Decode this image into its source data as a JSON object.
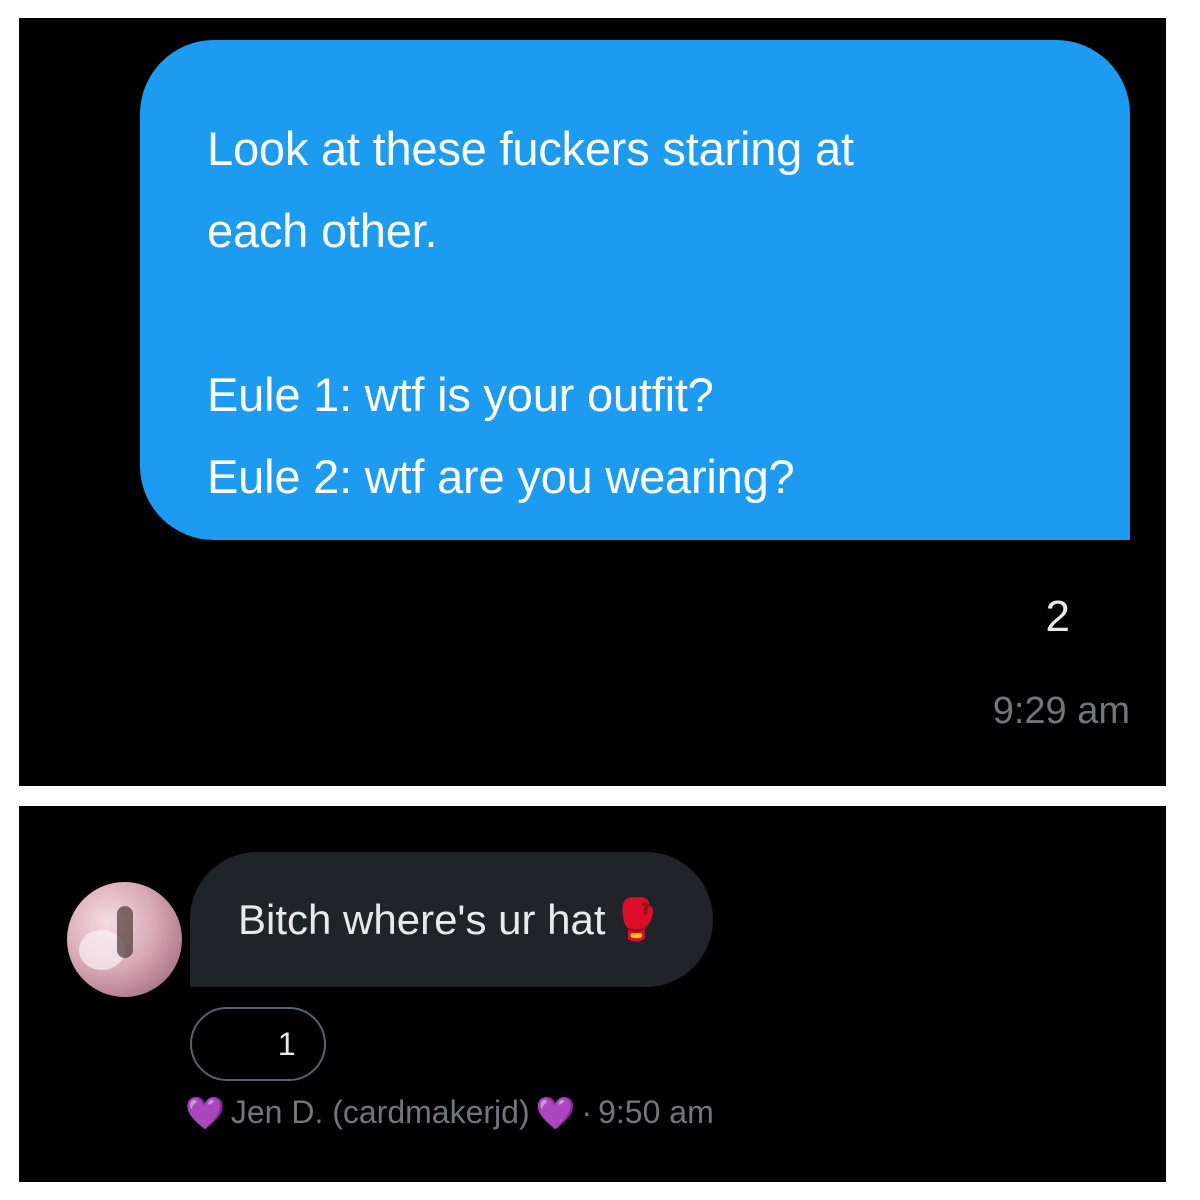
{
  "sent_message": {
    "lines": [
      "Look at these fuckers staring at",
      "each other.",
      "",
      "Eule 1: wtf is your outfit?",
      "Eule 2: wtf are you wearing?"
    ],
    "reaction": {
      "emoji": "😂",
      "emoji_name": "face-with-tears-of-joy",
      "count": "2"
    },
    "time": "9:29 am"
  },
  "received_message": {
    "text": "Bitch where's ur hat",
    "text_emoji": "🥊",
    "text_emoji_name": "boxing-glove",
    "reaction": {
      "emoji": "😂",
      "emoji_name": "face-with-tears-of-joy",
      "count": "1"
    },
    "sender": {
      "prefix_emoji": "💜",
      "name": "Jen D. (cardmakerjd)",
      "suffix_emoji": "💜",
      "separator": "·",
      "time": "9:50 am"
    }
  },
  "colors": {
    "sent_bubble": "#1d9bf0",
    "received_bubble": "#202327",
    "background": "#000000",
    "muted_text": "#71767b",
    "heart": "#a05ee8"
  }
}
